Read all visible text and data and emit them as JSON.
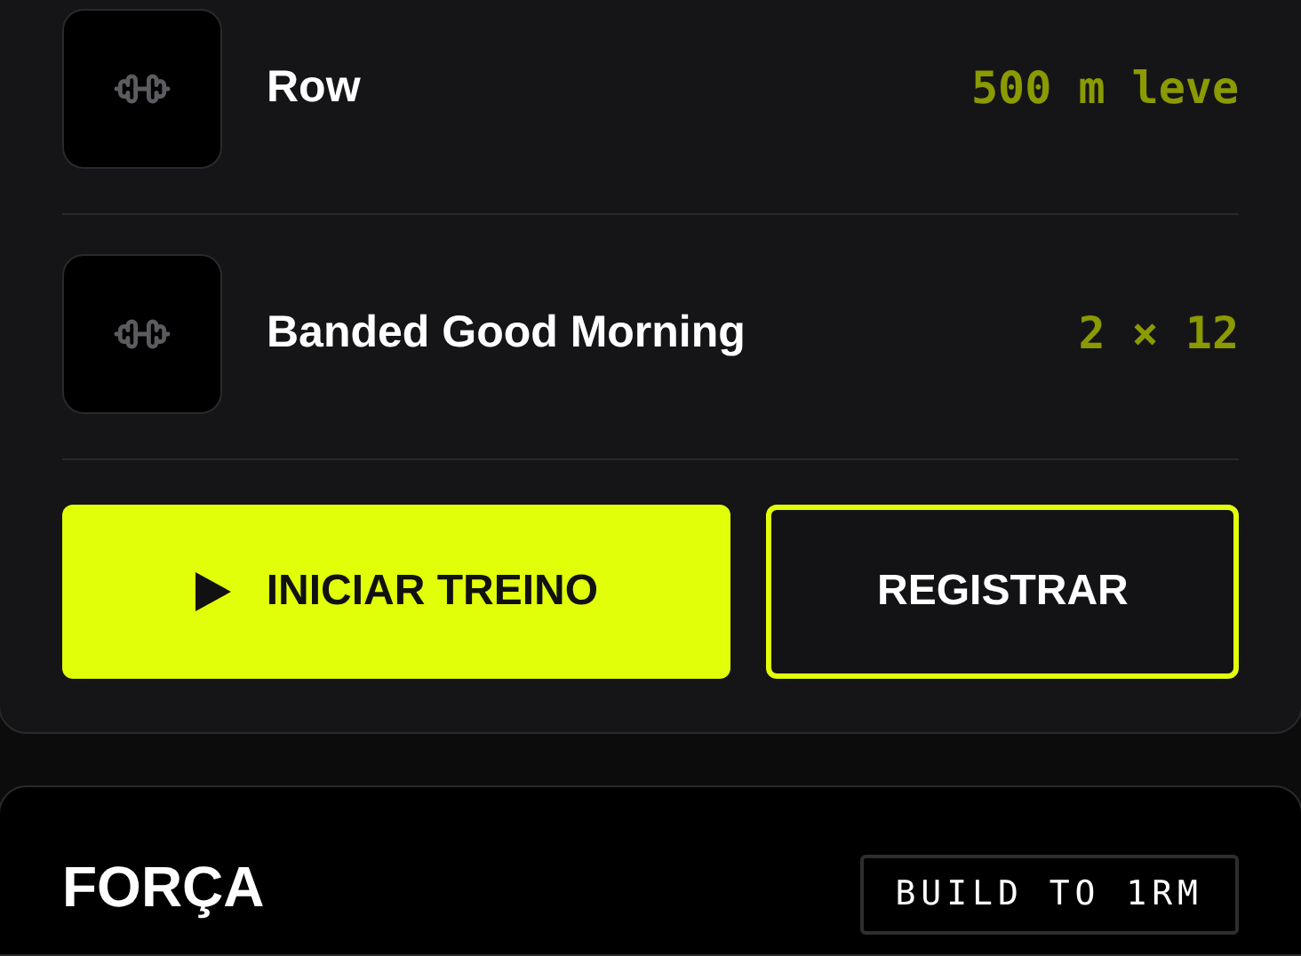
{
  "exercises": [
    {
      "name": "Row",
      "detail": "500 m leve"
    },
    {
      "name": "Banded Good Morning",
      "detail": "2 × 12"
    }
  ],
  "actions": [
    {
      "kind": "primary",
      "label": "INICIAR TREINO"
    },
    {
      "kind": "secondary",
      "label": "REGISTRAR"
    }
  ],
  "next_card": {
    "title": "FORÇA",
    "tag": "BUILD TO 1RM"
  }
}
